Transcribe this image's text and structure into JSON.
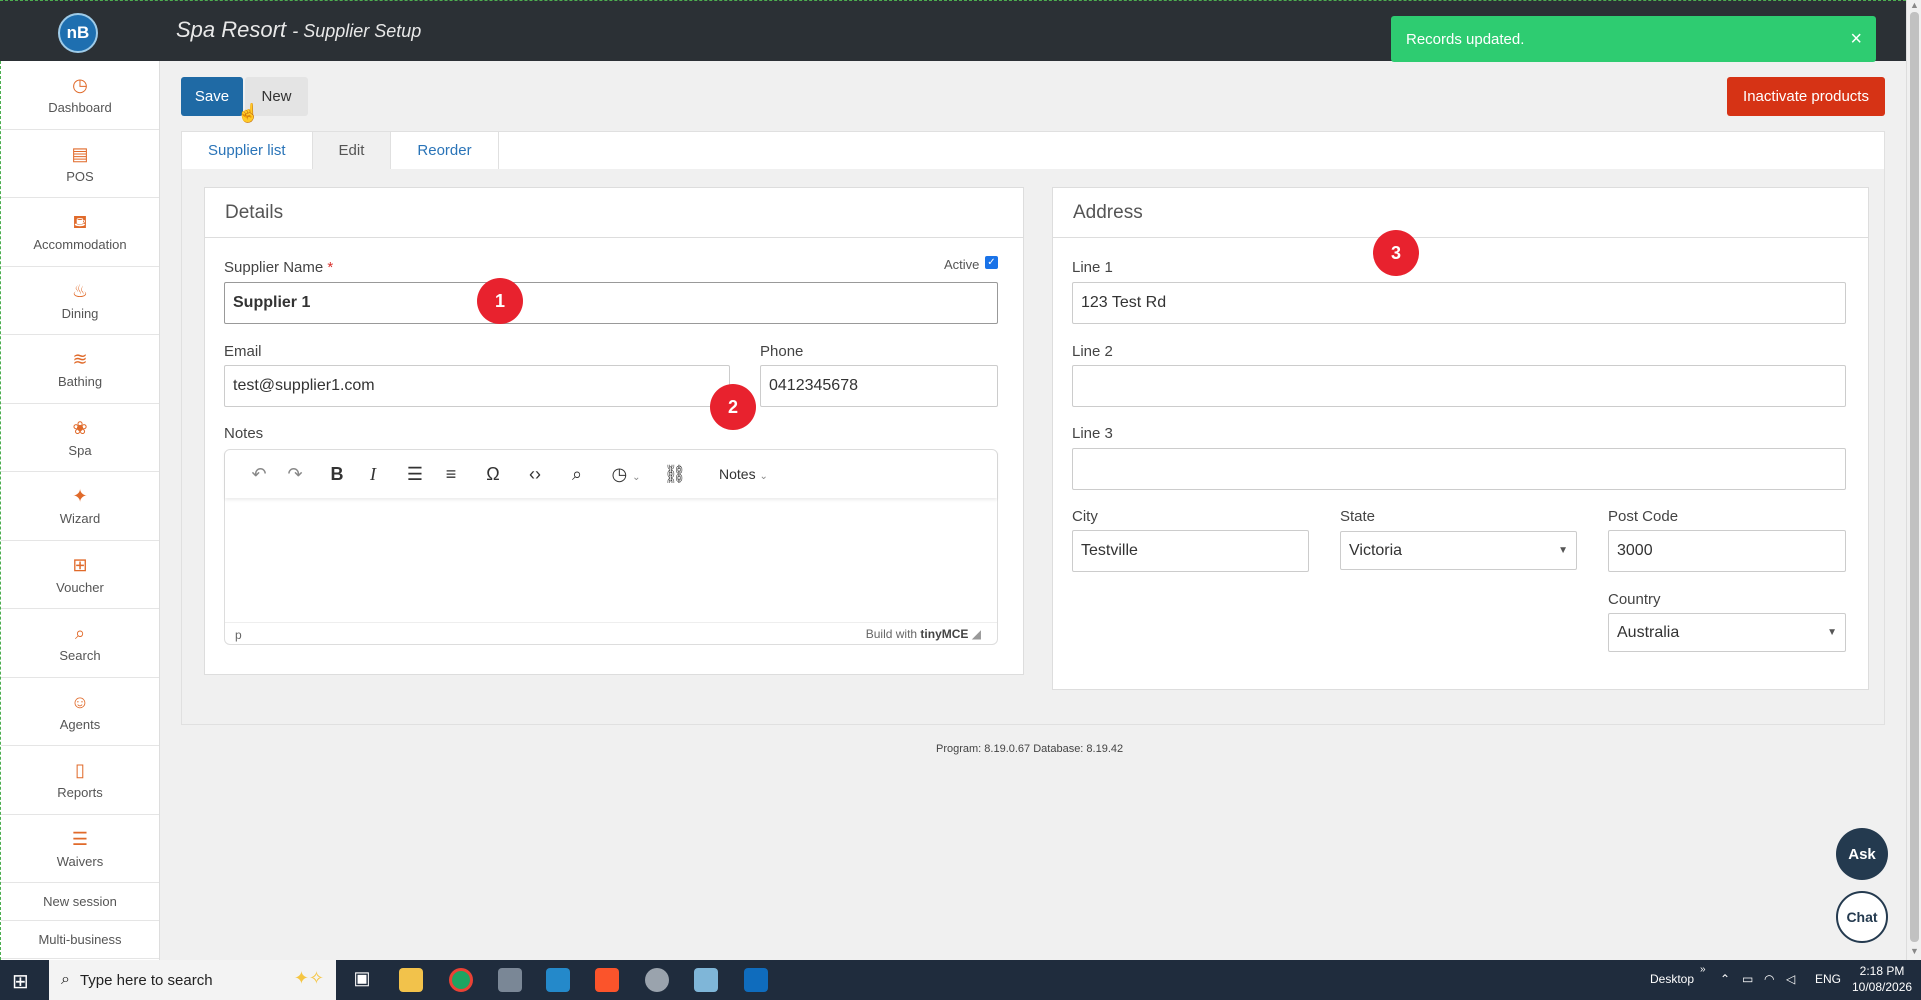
{
  "header": {
    "logo_text": "nB",
    "title": "Spa Resort",
    "subtitle": "Supplier Setup"
  },
  "toast": {
    "message": "Records updated.",
    "close": "×",
    "color": "#2ecc71"
  },
  "sidebar": {
    "items": [
      {
        "label": "Dashboard",
        "icon": "gauge-icon",
        "glyph": "◷"
      },
      {
        "label": "POS",
        "icon": "register-icon",
        "glyph": "▤"
      },
      {
        "label": "Accommodation",
        "icon": "bed-icon",
        "glyph": "⛾"
      },
      {
        "label": "Dining",
        "icon": "dining-icon",
        "glyph": "♨"
      },
      {
        "label": "Bathing",
        "icon": "waves-icon",
        "glyph": "≋"
      },
      {
        "label": "Spa",
        "icon": "lotus-icon",
        "glyph": "❀"
      },
      {
        "label": "Wizard",
        "icon": "wand-icon",
        "glyph": "✦"
      },
      {
        "label": "Voucher",
        "icon": "gift-icon",
        "glyph": "⊞"
      },
      {
        "label": "Search",
        "icon": "search-icon",
        "glyph": "⌕"
      },
      {
        "label": "Agents",
        "icon": "users-icon",
        "glyph": "☺"
      },
      {
        "label": "Reports",
        "icon": "document-icon",
        "glyph": "▯"
      },
      {
        "label": "Waivers",
        "icon": "checklist-icon",
        "glyph": "☰"
      }
    ],
    "new_session": "New session",
    "multi_business": "Multi-business",
    "accent": "#e06a2a"
  },
  "toolbar": {
    "save_label": "Save",
    "new_label": "New",
    "inactivate_label": "Inactivate products"
  },
  "tabs": [
    {
      "label": "Supplier list"
    },
    {
      "label": "Edit"
    },
    {
      "label": "Reorder"
    }
  ],
  "details": {
    "heading": "Details",
    "supplier_name_label": "Supplier Name",
    "required_marker": "*",
    "supplier_name_value": "Supplier 1",
    "active_label": "Active",
    "active_checked": true,
    "email_label": "Email",
    "email_value": "test@supplier1.com",
    "phone_label": "Phone",
    "phone_value": "0412345678",
    "notes_label": "Notes"
  },
  "editor": {
    "format_menu": "Notes",
    "status_path": "p",
    "build_with": "Build with",
    "brand": "tinyMCE"
  },
  "address": {
    "heading": "Address",
    "line1_label": "Line 1",
    "line1_value": "123 Test Rd",
    "line2_label": "Line 2",
    "line2_value": "",
    "line3_label": "Line 3",
    "line3_value": "",
    "city_label": "City",
    "city_value": "Testville",
    "state_label": "State",
    "state_value": "Victoria",
    "postcode_label": "Post Code",
    "postcode_value": "3000",
    "country_label": "Country",
    "country_value": "Australia"
  },
  "annotations": [
    "1",
    "2",
    "3"
  ],
  "footer": {
    "version": "Program: 8.19.0.67 Database: 8.19.42"
  },
  "help": {
    "ask": "Ask",
    "chat": "Chat"
  },
  "taskbar": {
    "search_placeholder": "Type here to search",
    "desktop": "Desktop",
    "lang": "ENG",
    "time": "2:18 PM",
    "date": "10/08/2026"
  }
}
